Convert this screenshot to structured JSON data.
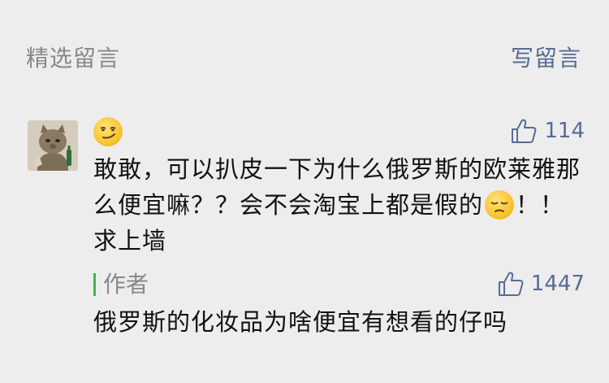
{
  "section": {
    "title": "精选留言",
    "write_label": "写留言"
  },
  "comment": {
    "like_count": "114",
    "text_part1": "敢敢，可以扒皮一下为什么俄罗斯的欧莱雅那么便宜嘛？？会不会淘宝上都是假的",
    "text_part2": "！！求上墙",
    "emoji_top": "smirk-emoji",
    "emoji_inline": "pensive-emoji"
  },
  "reply": {
    "author_label": "作者",
    "like_count": "1447",
    "text": "俄罗斯的化妆品为啥便宜有想看的仔吗"
  },
  "colors": {
    "background": "#ededed",
    "link": "#576b95",
    "muted": "#888888",
    "reply_bar": "#3fb34f"
  }
}
